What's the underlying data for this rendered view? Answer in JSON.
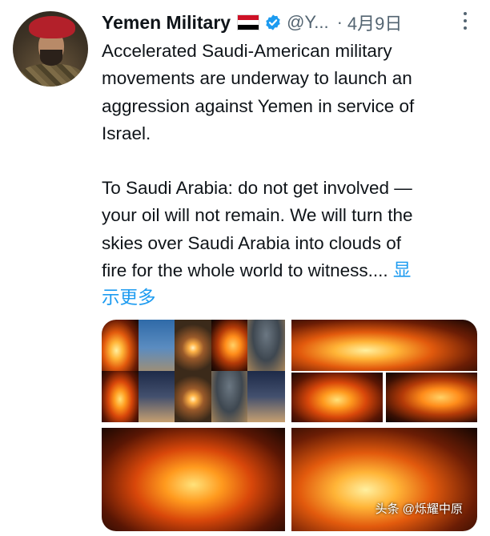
{
  "author": {
    "name": "Yemen Military",
    "handle": "@Y...",
    "date": "4月9日",
    "flag_colors": [
      "#ce1126",
      "#ffffff",
      "#000000"
    ],
    "verified_color": "#1d9bf0"
  },
  "tweet": {
    "lines": [
      "Accelerated Saudi-American military",
      "movements are underway to launch an",
      "aggression against Yemen in service of",
      "Israel.",
      "To Saudi Arabia: do not get involved —",
      "your oil will not remain. We will turn the",
      "skies over Saudi Arabia into clouds of",
      "fire for the whole world to witness...."
    ],
    "show_more_1": "显",
    "show_more_2": "示更多"
  },
  "watermark": "头条 @烁耀中原",
  "icons": {
    "more": "more-options-icon",
    "verified": "verified-badge-icon"
  }
}
